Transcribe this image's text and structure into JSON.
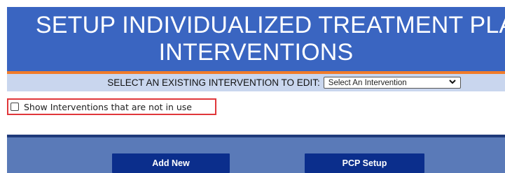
{
  "header": {
    "title_line1": "SETUP INDIVIDUALIZED TREATMENT PLAN",
    "title_line2": "INTERVENTIONS"
  },
  "intervention_select": {
    "label": "SELECT AN EXISTING INTERVENTION TO EDIT:",
    "selected": "Select An Intervention"
  },
  "filter": {
    "show_unused_label": "Show Interventions that are not in use",
    "checked": false
  },
  "footer": {
    "add_new_label": "Add New",
    "pcp_setup_label": "PCP Setup"
  },
  "colors": {
    "header_bg": "#3a65c1",
    "accent_orange": "#f07b2a",
    "select_row_bg": "#c9d6ee",
    "footer_bg": "#5a7ab8",
    "button_bg": "#0b2e8c",
    "highlight_border": "#e0363a"
  },
  "icons": {
    "dropdown": "chevron-down-icon"
  }
}
